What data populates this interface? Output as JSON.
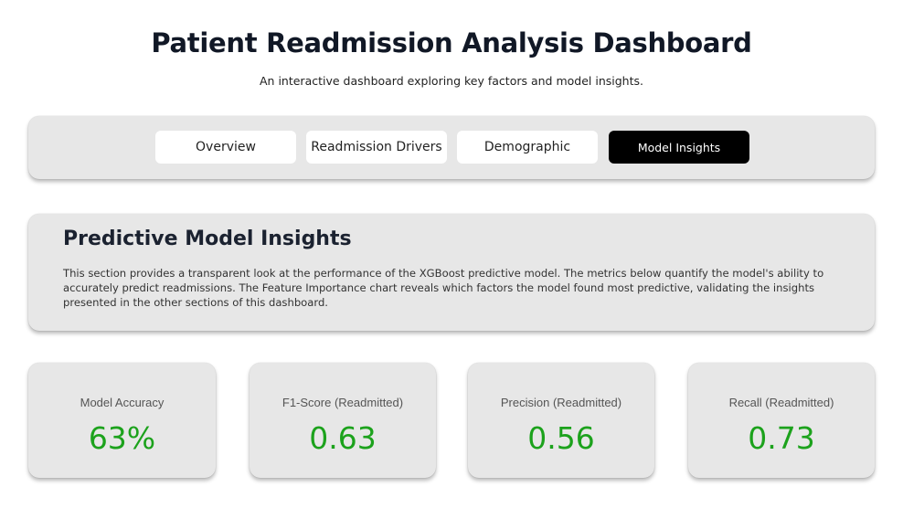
{
  "header": {
    "title": "Patient Readmission Analysis Dashboard",
    "subtitle": "An interactive dashboard exploring key factors and model insights."
  },
  "nav": {
    "tabs": [
      {
        "label": "Overview",
        "active": false
      },
      {
        "label": "Readmission Drivers",
        "active": false
      },
      {
        "label": "Demographic",
        "active": false
      },
      {
        "label": "Model Insights",
        "active": true
      }
    ]
  },
  "insights": {
    "heading": "Predictive Model Insights",
    "description": "This section provides a transparent look at the performance of the XGBoost predictive model. The metrics below quantify the model's ability to accurately predict readmissions. The Feature Importance chart reveals which factors the model found most predictive, validating the insights presented in the other sections of this dashboard."
  },
  "metrics": [
    {
      "label": "Model Accuracy",
      "value": "63%"
    },
    {
      "label": "F1-Score (Readmitted)",
      "value": "0.63"
    },
    {
      "label": "Precision (Readmitted)",
      "value": "0.56"
    },
    {
      "label": "Recall (Readmitted)",
      "value": "0.73"
    }
  ],
  "colors": {
    "metric_value": "#1ca21c",
    "active_tab_bg": "#000000",
    "card_bg": "#e7e7e7"
  }
}
